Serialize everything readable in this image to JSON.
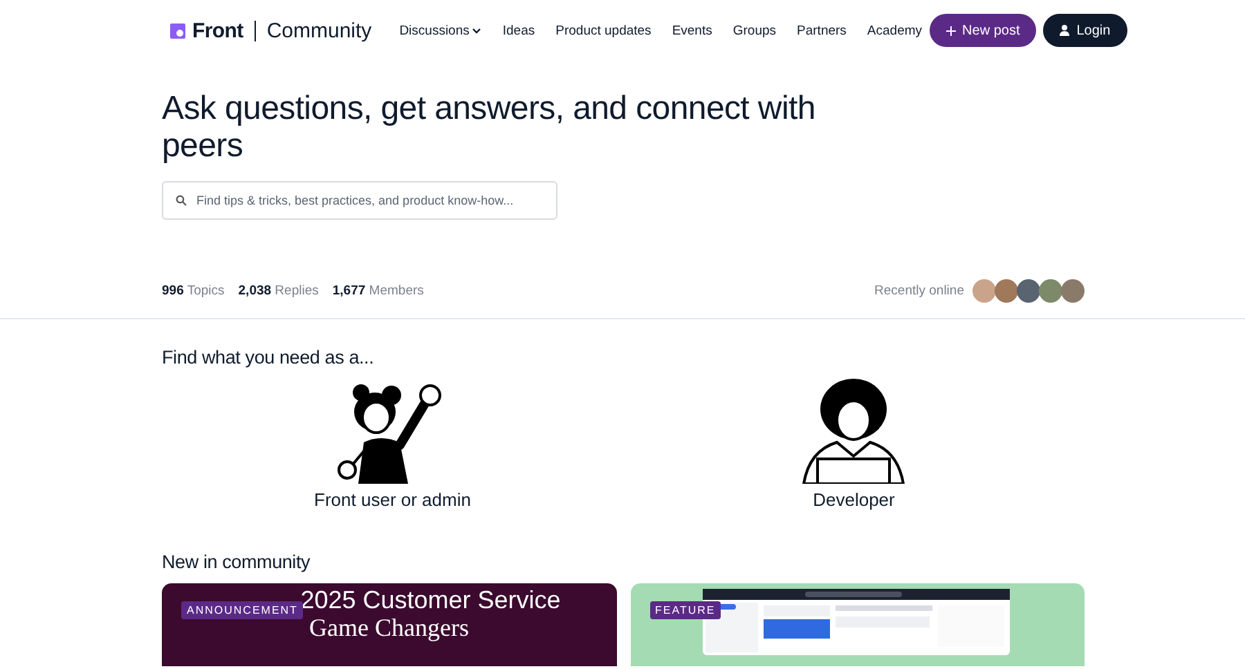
{
  "header": {
    "logo": {
      "brand": "Front",
      "product": "Community"
    },
    "nav": [
      {
        "label": "Discussions",
        "dropdown": true
      },
      {
        "label": "Ideas",
        "dropdown": false
      },
      {
        "label": "Product updates",
        "dropdown": false
      },
      {
        "label": "Events",
        "dropdown": false
      },
      {
        "label": "Groups",
        "dropdown": false
      },
      {
        "label": "Partners",
        "dropdown": false
      },
      {
        "label": "Academy",
        "dropdown": false
      }
    ],
    "new_post": "New post",
    "login": "Login"
  },
  "hero": {
    "title": "Ask questions, get answers, and connect with peers",
    "search": {
      "placeholder": "Find tips & tricks, best practices, and product know-how..."
    }
  },
  "stats": [
    "**996** Topics",
    "**2,038** Replies",
    "**1,677** Members"
  ],
  "recently_online": {
    "label": "Recently online",
    "avatars": [
      {
        "color": "#c9a48a"
      },
      {
        "color": "#a0785a"
      },
      {
        "color": "#5a6470"
      },
      {
        "color": "#7d8a6a"
      },
      {
        "color": "#8a7a6a"
      }
    ]
  },
  "roles": {
    "title": "Find what you need as a...",
    "items": [
      {
        "label": "Front user or admin",
        "kind": "user"
      },
      {
        "label": "Developer",
        "kind": "developer"
      }
    ]
  },
  "new_in_community": {
    "title": "New in community",
    "cards": [
      {
        "tag": "ANNOUNCEMENT",
        "kind": "banner",
        "headline": "2025 Customer Service",
        "subline": "Game Changers"
      },
      {
        "tag": "FEATURE",
        "kind": "picture"
      }
    ]
  }
}
